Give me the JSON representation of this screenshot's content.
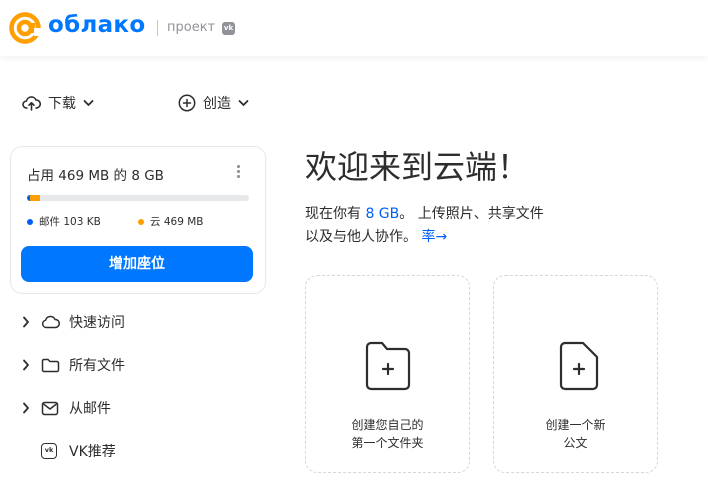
{
  "header": {
    "logo_text": "облако",
    "project_label": "проект",
    "vk_badge": "vk"
  },
  "toolbar": {
    "download_label": "下载",
    "create_label": "创造"
  },
  "storage": {
    "title": "占用 469 MB 的 8 GB",
    "used_mail_fraction": 0.0126,
    "used_cloud_fraction": 0.0573,
    "legend_mail": "邮件 103 KB",
    "legend_cloud": "云 469 MB",
    "add_button_label": "增加座位",
    "colors": {
      "mail": "#005ff9",
      "cloud": "#ff9e00",
      "button": "#0077ff"
    }
  },
  "sidebar": {
    "items": [
      {
        "label": "快速访问",
        "icon": "cloud-icon",
        "expandable": true
      },
      {
        "label": "所有文件",
        "icon": "folder-icon",
        "expandable": true
      },
      {
        "label": "从邮件",
        "icon": "mail-icon",
        "expandable": true
      },
      {
        "label": "VK推荐",
        "icon": "vk-icon",
        "expandable": false
      }
    ]
  },
  "main": {
    "welcome_title": "欢迎来到云端！",
    "welcome_line1_a": "现在你有 ",
    "welcome_line1_b": "8 GB",
    "welcome_line1_c": "。 上传照片、共享文件",
    "welcome_line2": "以及与他人协作。 ",
    "more_link": "率→",
    "tiles": [
      {
        "line1": "创建您自己的",
        "line2": "第一个文件夹",
        "icon": "folder-plus-icon"
      },
      {
        "line1": "创建一个新",
        "line2": "公文",
        "icon": "document-plus-icon"
      }
    ]
  }
}
